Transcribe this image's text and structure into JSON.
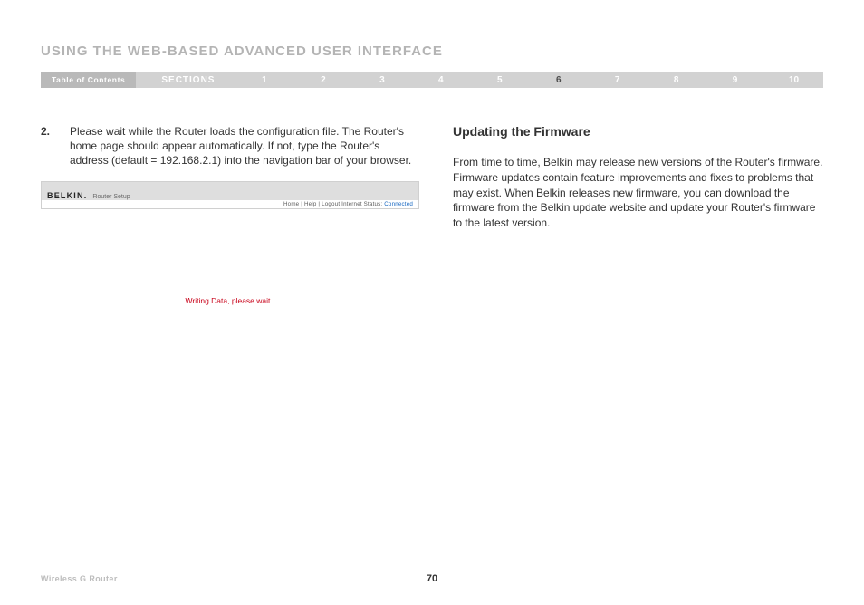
{
  "header": {
    "title": "USING THE WEB-BASED ADVANCED USER INTERFACE"
  },
  "nav": {
    "toc": "Table of Contents",
    "sections": "SECTIONS",
    "items": [
      "1",
      "2",
      "3",
      "4",
      "5",
      "6",
      "7",
      "8",
      "9",
      "10"
    ],
    "active": "6"
  },
  "left": {
    "step_number": "2.",
    "step_text": "Please wait while the Router loads the configuration file. The Router's home page should appear automatically. If not, type the Router's address (default = 192.168.2.1) into the navigation bar of your browser.",
    "mock": {
      "brand": "BELKIN.",
      "brand_sub": "Router Setup",
      "links": "Home | Help | Logout   Internet Status:",
      "status": "Connected",
      "loading": "Writing Data, please wait..."
    }
  },
  "right": {
    "heading": "Updating the Firmware",
    "body": "From time to time, Belkin may release new versions of the Router's firmware. Firmware updates contain feature improvements and fixes to problems that may exist. When Belkin releases new firmware, you can download the firmware from the Belkin update website and update your Router's firmware to the latest version."
  },
  "footer": {
    "left": "Wireless G Router",
    "page": "70"
  }
}
